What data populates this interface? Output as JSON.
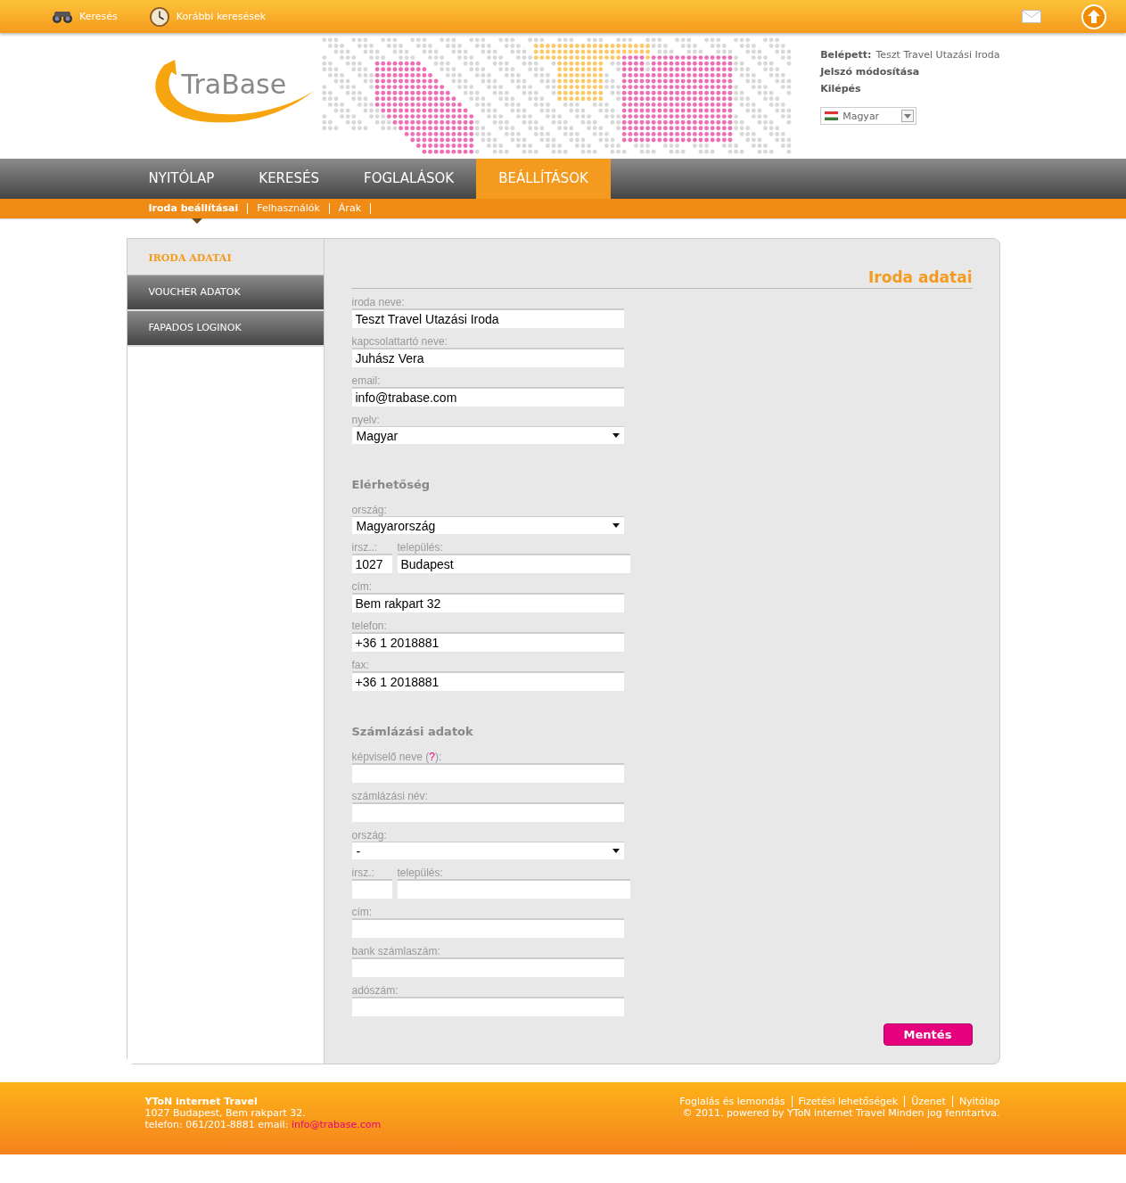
{
  "topbar": {
    "links": [
      {
        "label": "Keresés"
      },
      {
        "label": "Korábbi keresések"
      }
    ]
  },
  "header": {
    "logo": "TraBase",
    "logged_label": "Belépett:",
    "logged_name": "Teszt Travel Utazási Iroda",
    "links": [
      "Jelszó módosítása",
      "Kilépés"
    ],
    "language": "Magyar"
  },
  "nav": {
    "tabs": [
      {
        "label": "NYITÓLAP",
        "selected": false
      },
      {
        "label": "KERESÉS",
        "selected": false
      },
      {
        "label": "FOGLALÁSOK",
        "selected": false
      },
      {
        "label": "BEÁLLÍTÁSOK",
        "selected": true
      }
    ],
    "subtabs": [
      {
        "label": "Iroda beállításai",
        "selected": true
      },
      {
        "label": "Felhasználók",
        "selected": false
      },
      {
        "label": "Árak",
        "selected": false
      }
    ]
  },
  "sidebar": {
    "items": [
      {
        "label": "IRODA ADATAI",
        "selected": true
      },
      {
        "label": "VOUCHER ADATOK",
        "selected": false
      },
      {
        "label": "FAPADOS LOGINOK",
        "selected": false
      }
    ]
  },
  "panel": {
    "title": "Iroda adatai",
    "sections": [
      {
        "fields": [
          {
            "kind": "text",
            "label": "iroda neve:",
            "value": "Teszt Travel Utazási Iroda"
          },
          {
            "kind": "text",
            "label": "kapcsolattartó neve:",
            "value": "Juhász Vera"
          },
          {
            "kind": "text",
            "label": "email:",
            "value": "info@trabase.com"
          },
          {
            "kind": "select",
            "label": "nyelv:",
            "value": "Magyar"
          }
        ]
      },
      {
        "heading": "Elérhetőség",
        "fields": [
          {
            "kind": "select",
            "label": "ország:",
            "value": "Magyarország"
          },
          {
            "kind": "postcode_city",
            "label": "irsz..:",
            "value": "1027",
            "city_label": "település:",
            "city_value": "Budapest"
          },
          {
            "kind": "text",
            "label": "cím:",
            "value": "Bem rakpart 32"
          },
          {
            "kind": "text",
            "label": "telefon:",
            "value": "+36 1 2018881"
          },
          {
            "kind": "text",
            "label": "fax:",
            "value": "+36 1 2018881"
          }
        ]
      },
      {
        "heading": "Számlázási adatok",
        "fields": [
          {
            "kind": "text",
            "label": "képviselő neve (",
            "help": "?",
            "label_after": "):"
          },
          {
            "kind": "text",
            "label": "számlázási név:"
          },
          {
            "kind": "select",
            "label": "ország:",
            "value": "-"
          },
          {
            "kind": "postcode_city",
            "label": "irsz.:",
            "city_label": "település:"
          },
          {
            "kind": "text",
            "label": "cím:"
          },
          {
            "kind": "text",
            "label": "bank számlaszám:"
          },
          {
            "kind": "text",
            "label": "adószám:"
          }
        ]
      }
    ],
    "save_button": "Mentés"
  },
  "footer": {
    "company": "YToN internet Travel",
    "address": "1027 Budapest, Bem rakpart 32.",
    "contact": "telefon: 061/201-8881 email:",
    "email": "info@trabase.com",
    "links": [
      "Foglalás és lemondás",
      "Fizetési lehetőségek",
      "Üzenet",
      "Nyitólap"
    ],
    "copyright": "© 2011. powered by YToN internet Travel Minden jog fenntartva."
  }
}
